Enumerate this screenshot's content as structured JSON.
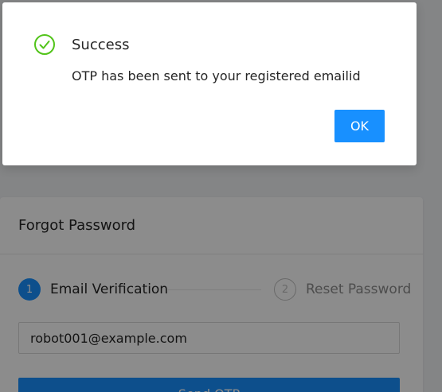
{
  "modal": {
    "title": "Success",
    "message": "OTP has been sent to your registered emailid",
    "ok_label": "OK",
    "icon": "check-circle-icon",
    "icon_color": "#52c41a"
  },
  "card": {
    "title": "Forgot Password",
    "steps": [
      {
        "number": "1",
        "label": "Email Verification",
        "status": "process"
      },
      {
        "number": "2",
        "label": "Reset Password",
        "status": "wait"
      }
    ],
    "email_value": "robot001@example.com",
    "send_button_label": "Send OTP"
  },
  "colors": {
    "primary": "#1890ff",
    "success": "#52c41a",
    "overlay": "rgba(0,0,0,0.45)"
  }
}
